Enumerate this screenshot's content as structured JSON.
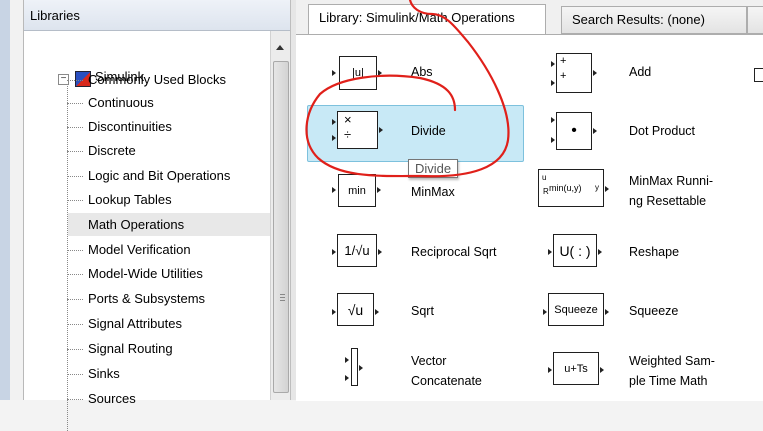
{
  "libraries_header": "Libraries",
  "tree": {
    "root": "Simulink",
    "items": [
      "Commonly Used Blocks",
      "Continuous",
      "Discontinuities",
      "Discrete",
      "Logic and Bit Operations",
      "Lookup Tables",
      "Math Operations",
      "Model Verification",
      "Model-Wide Utilities",
      "Ports & Subsystems",
      "Signal Attributes",
      "Signal Routing",
      "Sinks",
      "Sources"
    ],
    "selected": "Math Operations"
  },
  "tabs": {
    "active": "Library: Simulink/Math Operations",
    "search": "Search Results: (none)"
  },
  "blocks": {
    "abs": {
      "name": "Abs",
      "glyph": "|u|"
    },
    "add": {
      "name": "Add",
      "glyph_top": "+",
      "glyph_bottom": "+"
    },
    "divide": {
      "name": "Divide",
      "glyph_top": "×",
      "glyph_bottom": "÷"
    },
    "dot_product": {
      "name": "Dot Product",
      "glyph": "•"
    },
    "minmax": {
      "name": "MinMax",
      "glyph": "min"
    },
    "minmax_running": {
      "name_line1": "MinMax Runni-",
      "name_line2": "ng Resettable",
      "glyph": "min(u,y)",
      "port_u": "u",
      "port_r": "R",
      "port_y": "y"
    },
    "recip_sqrt": {
      "name": "Reciprocal Sqrt",
      "glyph": "1/√u"
    },
    "reshape": {
      "name": "Reshape",
      "glyph": "U( : )"
    },
    "sqrt": {
      "name": "Sqrt",
      "glyph": "√u"
    },
    "squeeze": {
      "name": "Squeeze",
      "glyph": "Squeeze"
    },
    "vector_concat": {
      "name_line1": "Vector",
      "name_line2": "Concatenate"
    },
    "weighted_sample": {
      "name_line1": "Weighted Sam-",
      "name_line2": "ple Time Math",
      "glyph": "u+Ts"
    }
  },
  "tooltip": "Divide",
  "annotation_color": "#e0201a"
}
